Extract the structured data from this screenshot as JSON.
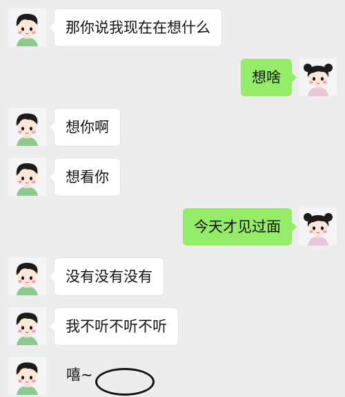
{
  "messages": [
    {
      "side": "left",
      "avatar": "boy-avatar",
      "text": "那你说我现在在想什么"
    },
    {
      "side": "right",
      "avatar": "girl-avatar",
      "text": "想啥"
    },
    {
      "side": "left",
      "avatar": "boy-avatar",
      "text": "想你啊"
    },
    {
      "side": "left",
      "avatar": "boy-avatar",
      "text": "想看你"
    },
    {
      "side": "right",
      "avatar": "girl-avatar",
      "text": "今天才见过面"
    },
    {
      "side": "left",
      "avatar": "boy-avatar",
      "text": "没有没有没有"
    },
    {
      "side": "left",
      "avatar": "boy-avatar",
      "text": "我不听不听不听"
    },
    {
      "side": "left",
      "avatar": "boy-avatar",
      "text": "嘻~"
    }
  ],
  "colors": {
    "background": "#ededed",
    "sent_bubble": "#95ec69",
    "received_bubble": "#ffffff"
  }
}
